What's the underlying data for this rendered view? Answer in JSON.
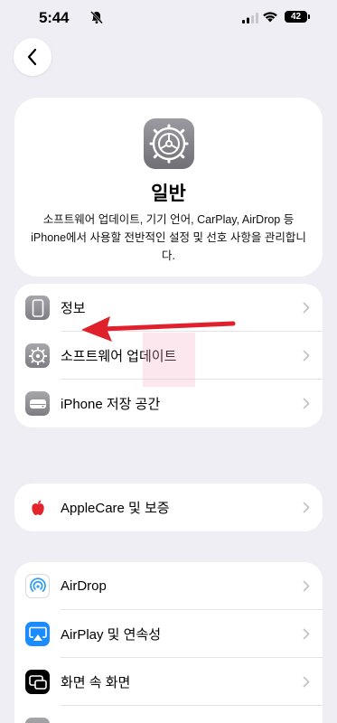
{
  "status_bar": {
    "time": "5:44",
    "battery": "42"
  },
  "header": {
    "title": "일반",
    "description": "소프트웨어 업데이트, 기기 언어, CarPlay, AirDrop 등 iPhone에서 사용할 전반적인 설정 및 선호 사항을 관리합니다.",
    "icon": "settings-gear-icon"
  },
  "group1": [
    {
      "label": "정보",
      "icon": "iphone-icon"
    },
    {
      "label": "소프트웨어 업데이트",
      "icon": "gear-icon"
    },
    {
      "label": "iPhone 저장 공간",
      "icon": "storage-icon"
    }
  ],
  "group2": [
    {
      "label": "AppleCare 및 보증",
      "icon": "apple-logo-icon"
    }
  ],
  "group3": [
    {
      "label": "AirDrop",
      "icon": "airdrop-icon"
    },
    {
      "label": "AirPlay 및 연속성",
      "icon": "airplay-icon"
    },
    {
      "label": "화면 속 화면",
      "icon": "picture-in-picture-icon"
    }
  ],
  "colors": {
    "background": "#efeef4",
    "card": "#ffffff",
    "annotation_arrow": "#e0202a",
    "airplay_blue": "#1a8cff"
  }
}
